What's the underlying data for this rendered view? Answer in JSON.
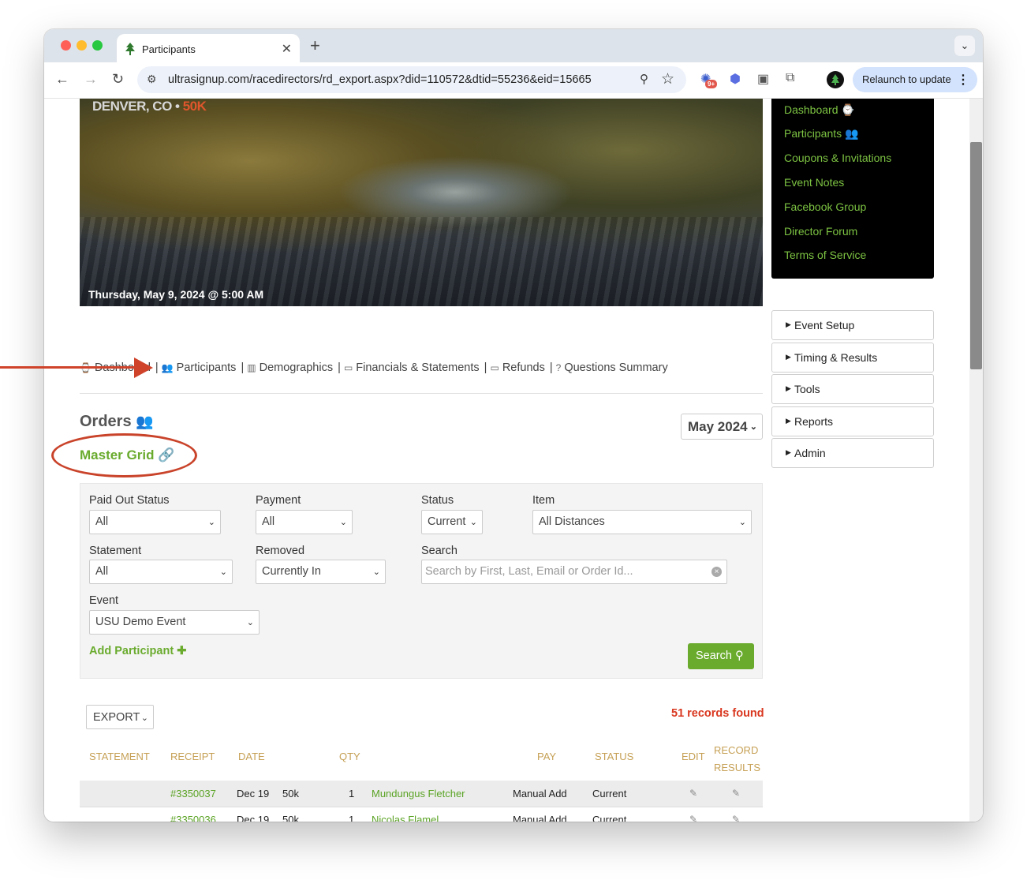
{
  "browser": {
    "tab_title": "Participants",
    "url": "ultrasignup.com/racedirectors/rd_export.aspx?did=110572&dtid=55236&eid=15665",
    "extension_badge": "9+",
    "relaunch_label": "Relaunch to update"
  },
  "hero": {
    "location": "DENVER, CO •",
    "distance": "50K",
    "date": "Thursday, May 9, 2024 @ 5:00 AM"
  },
  "sidebar": {
    "links": [
      "Dashboard",
      "Participants",
      "Coupons & Invitations",
      "Event Notes",
      "Facebook Group",
      "Director Forum",
      "Terms of Service"
    ],
    "sections": [
      "Event Setup",
      "Timing & Results",
      "Tools",
      "Reports",
      "Admin"
    ]
  },
  "subnav": {
    "dashboard": "Dashboard",
    "participants": "Participants",
    "demographics": "Demographics",
    "financials": "Financials & Statements",
    "refunds": "Refunds",
    "questions": "Questions Summary"
  },
  "orders": {
    "title": "Orders",
    "master_grid": "Master Grid",
    "month": "May 2024"
  },
  "filters": {
    "paid_out_status": {
      "label": "Paid Out Status",
      "value": "All"
    },
    "payment": {
      "label": "Payment",
      "value": "All"
    },
    "status": {
      "label": "Status",
      "value": "Current"
    },
    "item": {
      "label": "Item",
      "value": "All Distances"
    },
    "statement": {
      "label": "Statement",
      "value": "All"
    },
    "removed": {
      "label": "Removed",
      "value": "Currently In"
    },
    "search": {
      "label": "Search",
      "placeholder": "Search by First, Last, Email or Order Id..."
    },
    "event": {
      "label": "Event",
      "value": "USU Demo Event"
    },
    "add_participant": "Add Participant",
    "search_button": "Search"
  },
  "results": {
    "export_label": "EXPORT",
    "records_found": "51 records found",
    "headers": {
      "statement": "STATEMENT",
      "receipt": "RECEIPT",
      "date": "DATE",
      "qty": "QTY",
      "pay": "PAY",
      "status": "STATUS",
      "edit": "EDIT",
      "record1": "RECORD",
      "record2": "RESULTS"
    },
    "rows": [
      {
        "receipt": "#3350037",
        "date": "Dec 19",
        "distance": "50k",
        "qty": "1",
        "name": "Mundungus Fletcher",
        "pay": "Manual Add",
        "status": "Current"
      },
      {
        "receipt": "#3350036",
        "date": "Dec 19",
        "distance": "50k",
        "qty": "1",
        "name": "Nicolas Flamel",
        "pay": "Manual Add",
        "status": "Current"
      }
    ]
  },
  "colors": {
    "brand_green": "#6aab2e",
    "accent_red": "#d0432b",
    "header_gold": "#c6a055"
  }
}
